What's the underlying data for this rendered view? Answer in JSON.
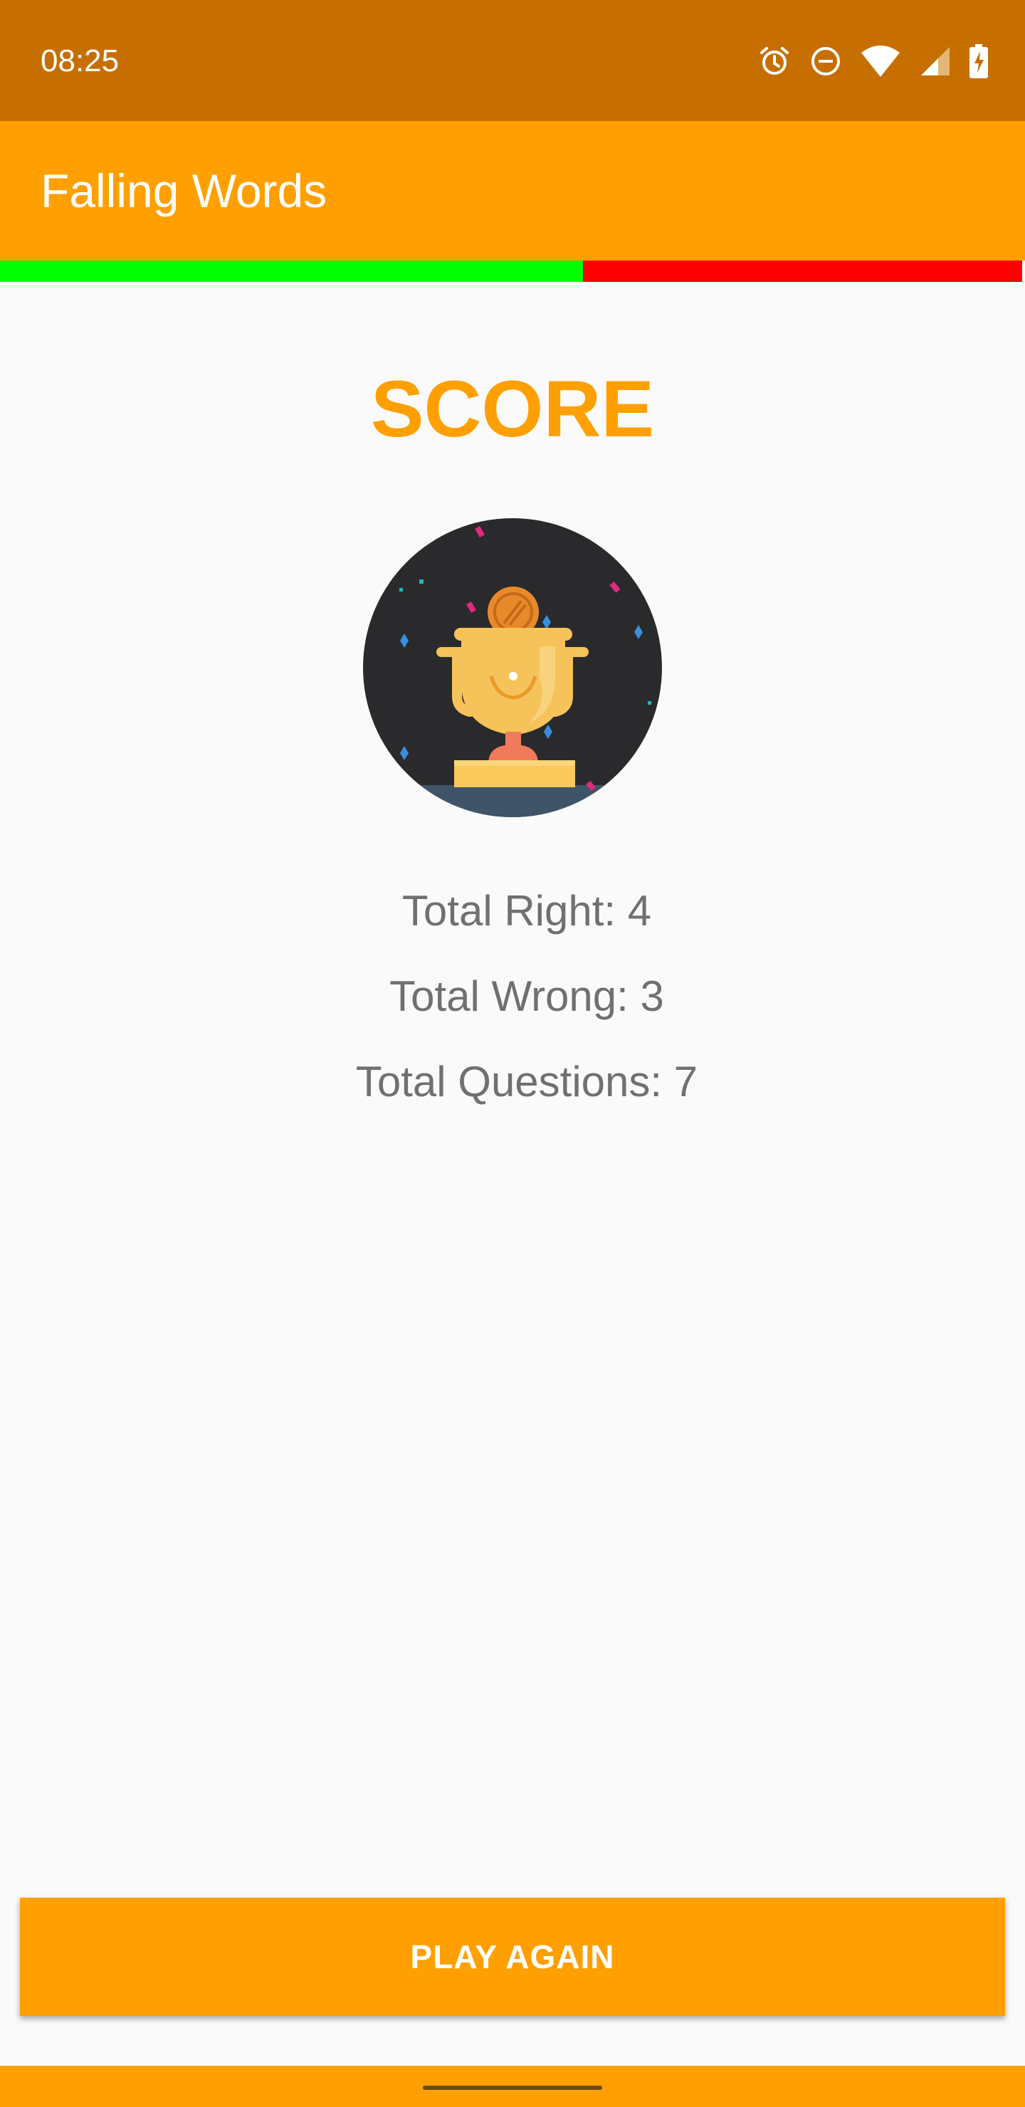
{
  "status_bar": {
    "time": "08:25",
    "background": "#c66f00",
    "icons": [
      "alarm-icon",
      "do-not-disturb-icon",
      "wifi-icon",
      "cell-signal-icon",
      "battery-charging-icon"
    ]
  },
  "app_bar": {
    "title": "Falling Words",
    "background": "#ffa000"
  },
  "progress": {
    "right_fraction": 0.57,
    "right_color": "#00ff00",
    "wrong_color": "#ff0000"
  },
  "score": {
    "heading": "SCORE",
    "trophy_icon": "trophy-icon",
    "total_right": "Total Right: 4",
    "total_wrong": "Total Wrong: 3",
    "total_questions": "Total Questions: 7"
  },
  "actions": {
    "play_again_label": "PLAY AGAIN"
  },
  "colors": {
    "accent": "#ffa000",
    "text_secondary": "#707070",
    "background": "#fafafa"
  }
}
